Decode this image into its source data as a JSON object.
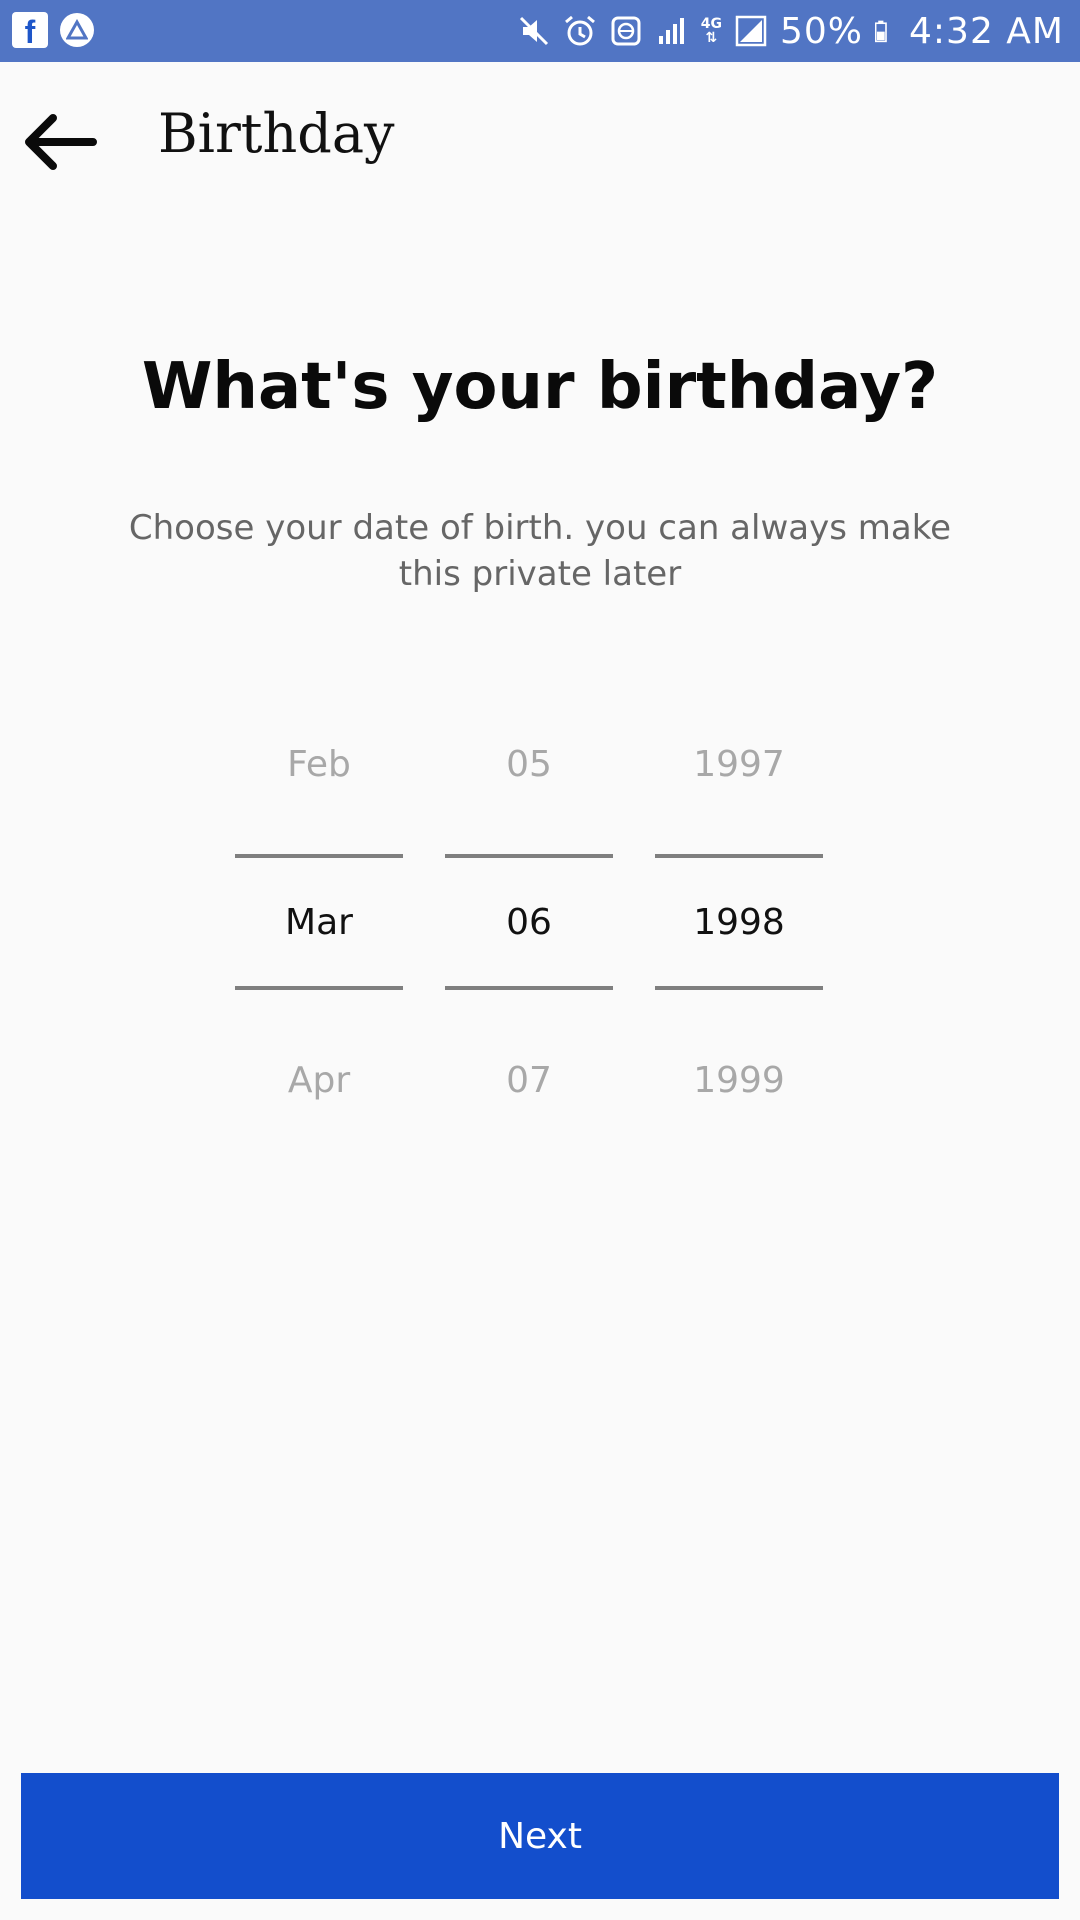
{
  "status_bar": {
    "battery_percent": "50%",
    "time": "4:32 AM",
    "network": "4G",
    "icons": [
      "facebook-icon",
      "triangle-app-icon",
      "mute-icon",
      "alarm-icon",
      "data-saver-icon",
      "signal-icon",
      "network-4g-icon",
      "signal-full-icon",
      "battery-icon"
    ]
  },
  "app_bar": {
    "title": "Birthday",
    "back_icon": "arrow-back-icon"
  },
  "main": {
    "heading": "What's your birthday?",
    "subtitle": "Choose your date of birth. you can always make this private later"
  },
  "picker": {
    "month": {
      "prev": "Feb",
      "selected": "Mar",
      "next": "Apr"
    },
    "day": {
      "prev": "05",
      "selected": "06",
      "next": "07"
    },
    "year": {
      "prev": "1997",
      "selected": "1998",
      "next": "1999"
    }
  },
  "next_button": {
    "label": "Next"
  },
  "colors": {
    "status_bar": "#5175c4",
    "primary_button": "#134ecc",
    "background": "#fafafa",
    "divider": "#7f7f7f"
  }
}
